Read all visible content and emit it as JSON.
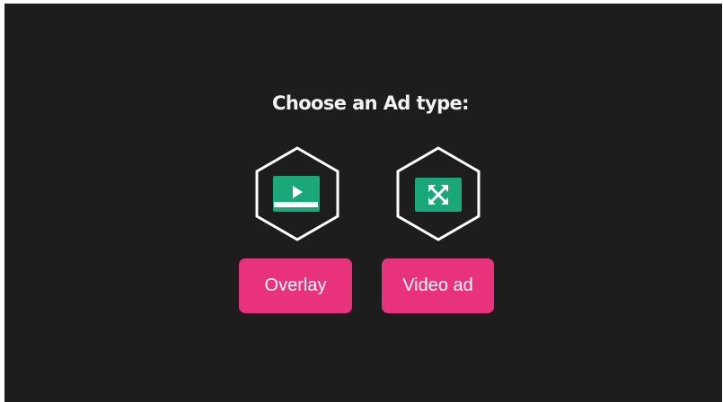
{
  "heading": "Choose an Ad type:",
  "options": [
    {
      "label": "Overlay",
      "icon": "play-banner-icon"
    },
    {
      "label": "Video ad",
      "icon": "expand-arrows-icon"
    }
  ],
  "colors": {
    "background": "#1d1d1d",
    "button": "#e8327c",
    "icon_fill": "#1aa77a",
    "hex_stroke": "#ffffff"
  }
}
